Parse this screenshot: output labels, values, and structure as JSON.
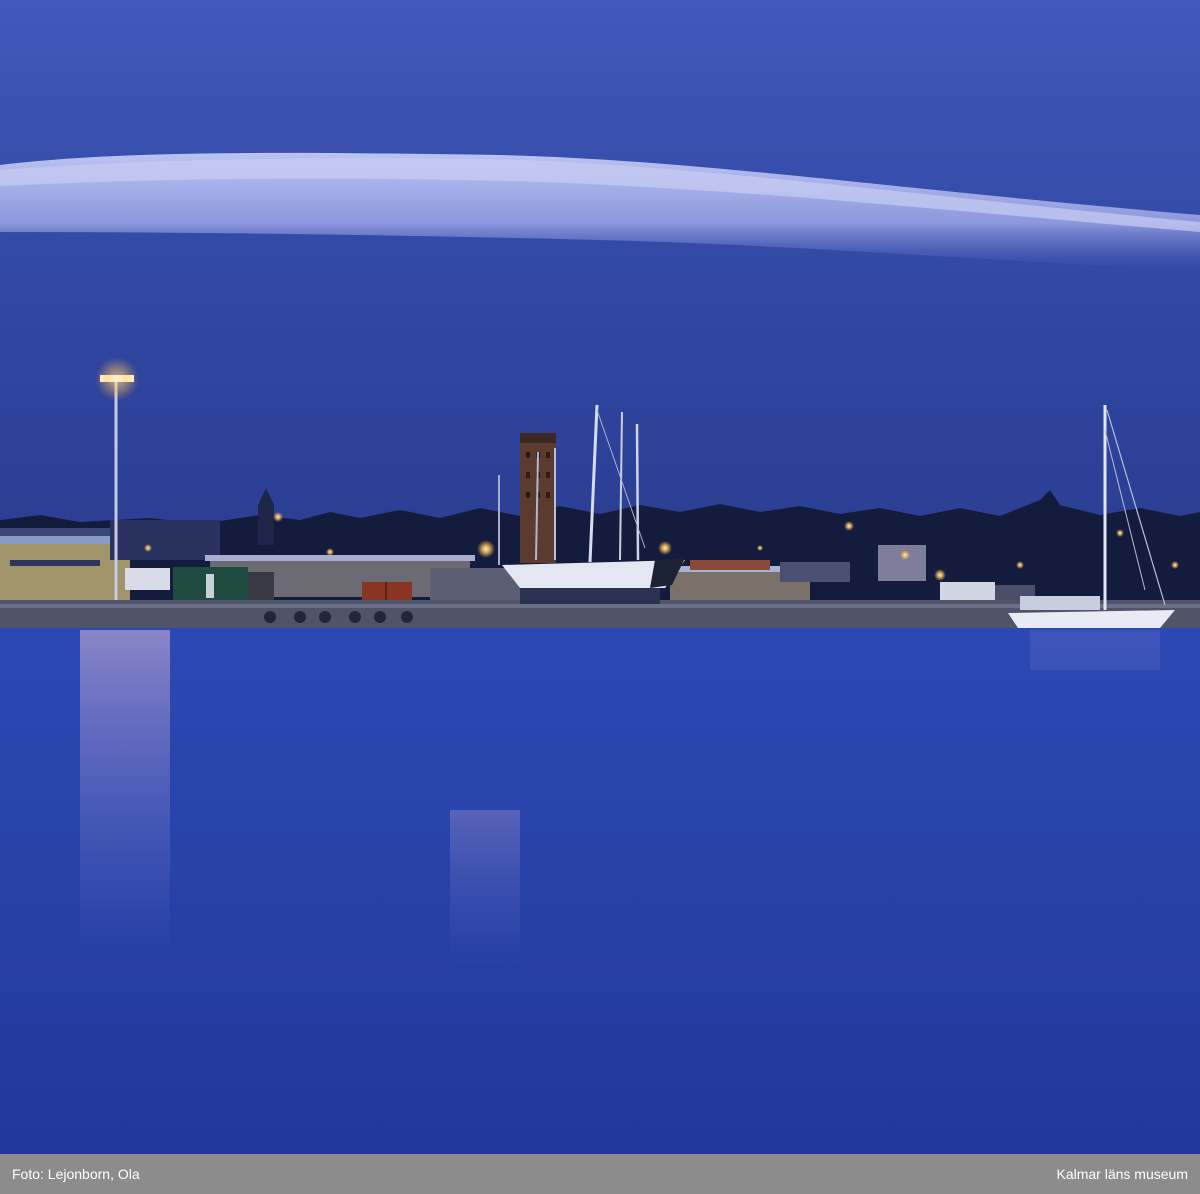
{
  "caption": {
    "photographer": "Foto: Lejonborn, Ola",
    "institution": "Kalmar läns museum"
  },
  "palette": {
    "sky_top": "#3d55b8",
    "sky_bottom": "#2c3f96",
    "water_top": "#2a45b0",
    "water_bottom": "#24389e",
    "cloud": "#a8b2ee",
    "caption_bar": "#8c8c8c",
    "light_glow": "#ffd27a"
  }
}
